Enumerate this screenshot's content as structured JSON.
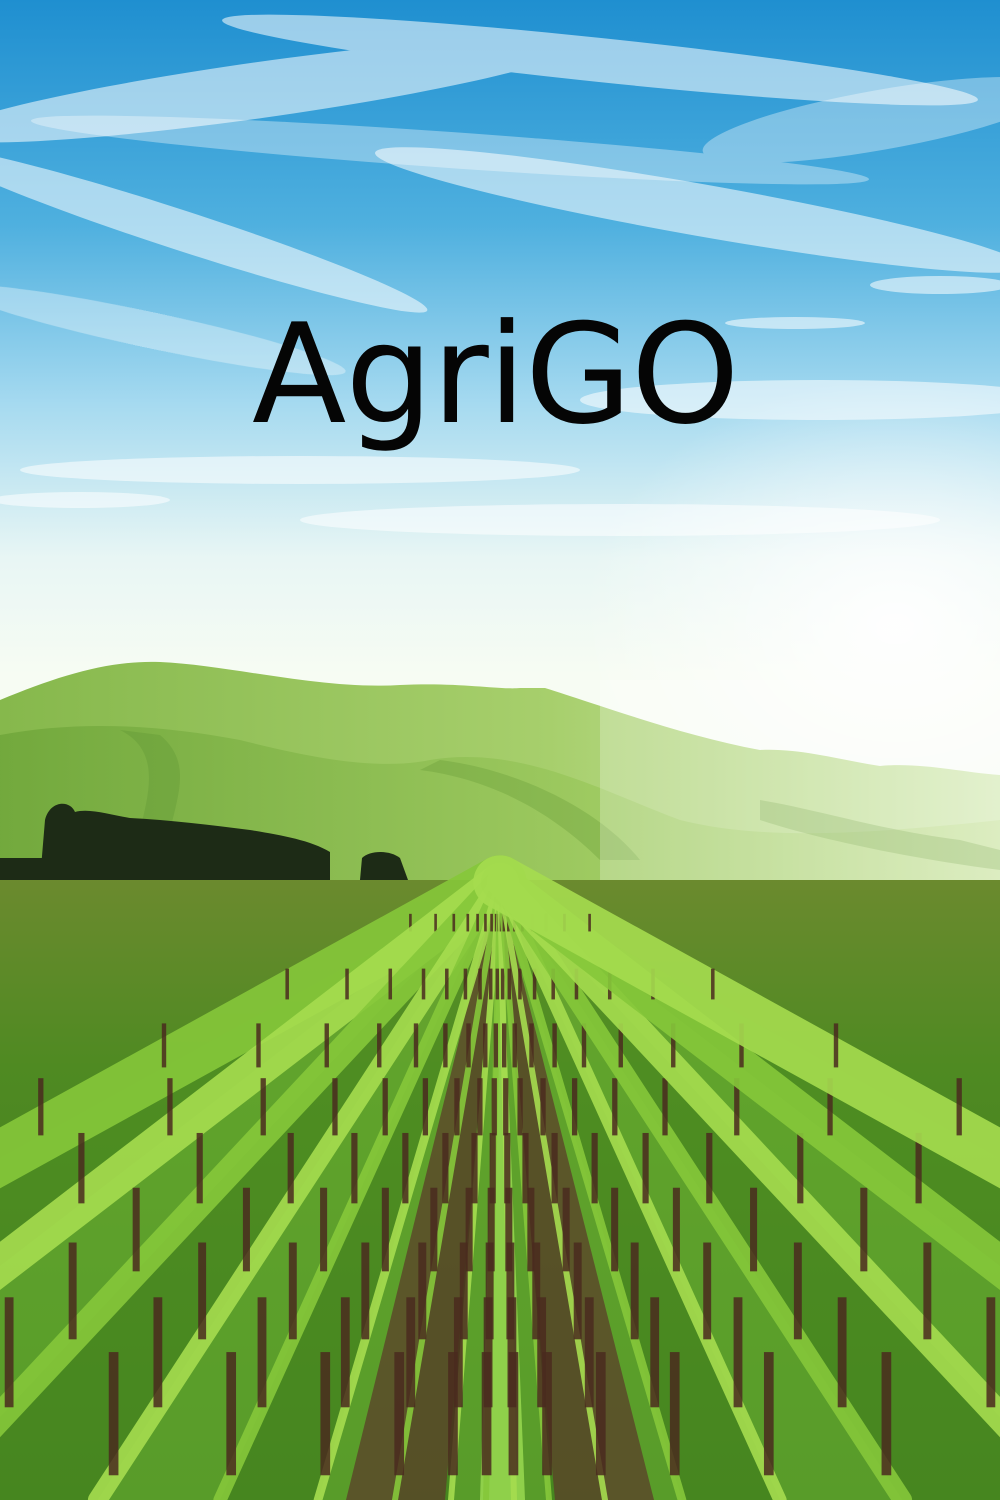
{
  "app": {
    "title": "AgriGO"
  },
  "colors": {
    "sky_top": "#1f8fd0",
    "sky_mid": "#7fc9ea",
    "horizon_glow": "#f4fbf2",
    "hills": "#7fb54a",
    "hills_light": "#c9e6a0",
    "crop_green": "#5fae2a",
    "crop_bright": "#a6dd4f",
    "soil": "#5b3e2a",
    "title_text": "#050505"
  },
  "icons": {
    "background": "vineyard-landscape-icon"
  }
}
